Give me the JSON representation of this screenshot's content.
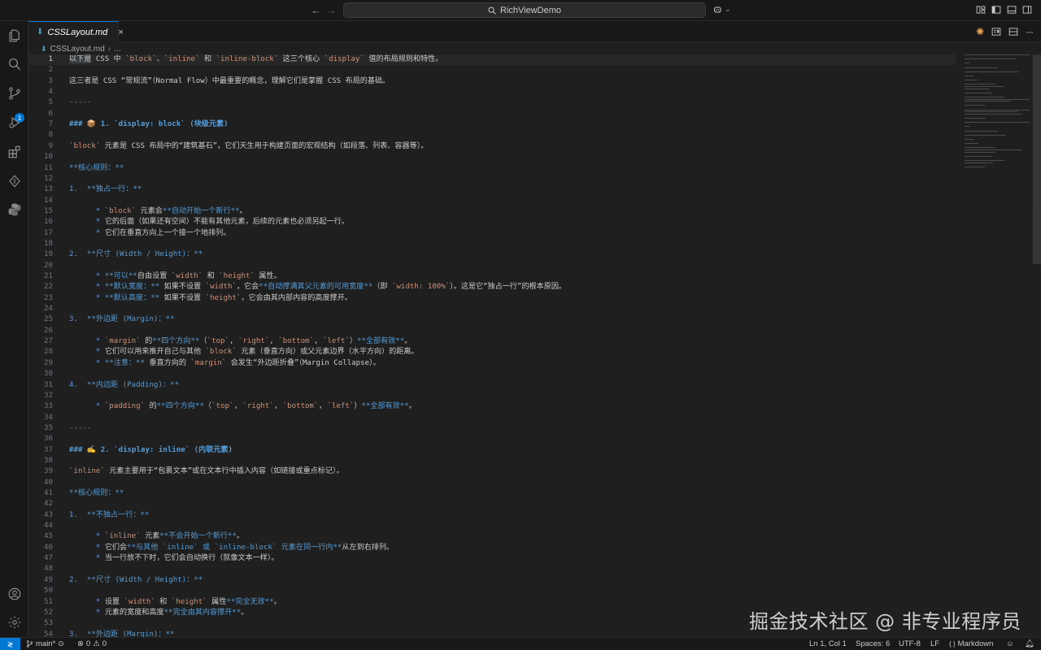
{
  "window": {
    "title": "RichViewDemo",
    "back_icon": "arrow-left-icon",
    "forward_icon": "arrow-right-icon"
  },
  "activity_bar": {
    "items": [
      "explorer-icon",
      "search-icon",
      "source-control-icon",
      "run-debug-icon",
      "extensions-icon",
      "remote-explorer-icon",
      "python-icon"
    ],
    "scm_badge": "1",
    "bottom_items": [
      "account-icon",
      "manage-gear-icon"
    ]
  },
  "tab": {
    "label": "CSSLayout.md",
    "close": "×"
  },
  "breadcrumb": {
    "file": "CSSLayout.md",
    "more": "..."
  },
  "editor": {
    "lines": [
      {
        "n": "1",
        "parts": [
          {
            "t": "以下是",
            "c": "hl"
          },
          {
            "t": " CSS 中 "
          },
          {
            "t": "`block`",
            "c": "code"
          },
          {
            "t": "、"
          },
          {
            "t": "`inline`",
            "c": "code"
          },
          {
            "t": " 和 "
          },
          {
            "t": "`inline-block`",
            "c": "code"
          },
          {
            "t": " 这三个核心 "
          },
          {
            "t": "`display`",
            "c": "code"
          },
          {
            "t": " 值的布局规则和特性。"
          }
        ]
      },
      {
        "n": "2",
        "parts": []
      },
      {
        "n": "3",
        "parts": [
          {
            "t": "这三者是 CSS “常规流”（Normal Flow）中最重要的概念，理解它们是掌握 CSS 布局的基础。"
          }
        ]
      },
      {
        "n": "4",
        "parts": []
      },
      {
        "n": "5",
        "parts": [
          {
            "t": "-----",
            "c": "hr"
          }
        ]
      },
      {
        "n": "6",
        "parts": []
      },
      {
        "n": "7",
        "parts": [
          {
            "t": "### 📦 1. `display: block` (块级元素)",
            "c": "head"
          }
        ]
      },
      {
        "n": "8",
        "parts": []
      },
      {
        "n": "9",
        "parts": [
          {
            "t": "`block`",
            "c": "code"
          },
          {
            "t": " 元素是 CSS 布局中的“建筑基石”，它们天生用于构建页面的宏观结构（如段落、列表、容器等）。"
          }
        ]
      },
      {
        "n": "10",
        "parts": []
      },
      {
        "n": "11",
        "parts": [
          {
            "t": "**核心规则：**",
            "c": "bold"
          }
        ]
      },
      {
        "n": "12",
        "parts": []
      },
      {
        "n": "13",
        "parts": [
          {
            "t": "1.  ",
            "c": "bullet"
          },
          {
            "t": "**独占一行：**",
            "c": "bold"
          }
        ]
      },
      {
        "n": "14",
        "parts": []
      },
      {
        "n": "15",
        "parts": [
          {
            "t": "      * ",
            "c": "bullet"
          },
          {
            "t": "`block`",
            "c": "code"
          },
          {
            "t": " 元素会"
          },
          {
            "t": "**自动开始一个新行**",
            "c": "bold"
          },
          {
            "t": "。"
          }
        ]
      },
      {
        "n": "16",
        "parts": [
          {
            "t": "      * ",
            "c": "bullet"
          },
          {
            "t": "它的后面（如果还有空间）不能有其他元素，后续的元素也必须另起一行。"
          }
        ]
      },
      {
        "n": "17",
        "parts": [
          {
            "t": "      * ",
            "c": "bullet"
          },
          {
            "t": "它们在垂直方向上一个接一个地排列。"
          }
        ]
      },
      {
        "n": "18",
        "parts": []
      },
      {
        "n": "19",
        "parts": [
          {
            "t": "2.  ",
            "c": "bullet"
          },
          {
            "t": "**尺寸 (Width / Height)：**",
            "c": "bold"
          }
        ]
      },
      {
        "n": "20",
        "parts": []
      },
      {
        "n": "21",
        "parts": [
          {
            "t": "      * ",
            "c": "bullet"
          },
          {
            "t": "**可以**",
            "c": "bold"
          },
          {
            "t": "自由设置 "
          },
          {
            "t": "`width`",
            "c": "code"
          },
          {
            "t": " 和 "
          },
          {
            "t": "`height`",
            "c": "code"
          },
          {
            "t": " 属性。"
          }
        ]
      },
      {
        "n": "22",
        "parts": [
          {
            "t": "      * ",
            "c": "bullet"
          },
          {
            "t": "**默认宽度：**",
            "c": "bold"
          },
          {
            "t": " 如果不设置 "
          },
          {
            "t": "`width`",
            "c": "code"
          },
          {
            "t": "，它会"
          },
          {
            "t": "**自动撑满其父元素的可用宽度**",
            "c": "bold"
          },
          {
            "t": "（即 "
          },
          {
            "t": "`width: 100%`",
            "c": "code"
          },
          {
            "t": "）。这是它“独占一行”的根本原因。"
          }
        ]
      },
      {
        "n": "23",
        "parts": [
          {
            "t": "      * ",
            "c": "bullet"
          },
          {
            "t": "**默认高度：**",
            "c": "bold"
          },
          {
            "t": " 如果不设置 "
          },
          {
            "t": "`height`",
            "c": "code"
          },
          {
            "t": "，它会由其内部内容的高度撑开。"
          }
        ]
      },
      {
        "n": "24",
        "parts": []
      },
      {
        "n": "25",
        "parts": [
          {
            "t": "3.  ",
            "c": "bullet"
          },
          {
            "t": "**外边距 (Margin)：**",
            "c": "bold"
          }
        ]
      },
      {
        "n": "26",
        "parts": []
      },
      {
        "n": "27",
        "parts": [
          {
            "t": "      * ",
            "c": "bullet"
          },
          {
            "t": "`margin`",
            "c": "code"
          },
          {
            "t": " 的"
          },
          {
            "t": "**四个方向**",
            "c": "bold"
          },
          {
            "t": "（"
          },
          {
            "t": "`top`",
            "c": "code"
          },
          {
            "t": ", "
          },
          {
            "t": "`right`",
            "c": "code"
          },
          {
            "t": ", "
          },
          {
            "t": "`bottom`",
            "c": "code"
          },
          {
            "t": ", "
          },
          {
            "t": "`left`",
            "c": "code"
          },
          {
            "t": "）"
          },
          {
            "t": "**全部有效**",
            "c": "bold"
          },
          {
            "t": "。"
          }
        ]
      },
      {
        "n": "28",
        "parts": [
          {
            "t": "      * ",
            "c": "bullet"
          },
          {
            "t": "它们可以用来推开自己与其他 "
          },
          {
            "t": "`block`",
            "c": "code"
          },
          {
            "t": " 元素（垂直方向）或父元素边界（水平方向）的距离。"
          }
        ]
      },
      {
        "n": "29",
        "parts": [
          {
            "t": "      * ",
            "c": "bullet"
          },
          {
            "t": "**注意：**",
            "c": "bold"
          },
          {
            "t": " 垂直方向的 "
          },
          {
            "t": "`margin`",
            "c": "code"
          },
          {
            "t": " 会发生“外边距折叠”（Margin Collapse）。"
          }
        ]
      },
      {
        "n": "30",
        "parts": []
      },
      {
        "n": "31",
        "parts": [
          {
            "t": "4.  ",
            "c": "bullet"
          },
          {
            "t": "**内边距 (Padding)：**",
            "c": "bold"
          }
        ]
      },
      {
        "n": "32",
        "parts": []
      },
      {
        "n": "33",
        "parts": [
          {
            "t": "      * ",
            "c": "bullet"
          },
          {
            "t": "`padding`",
            "c": "code"
          },
          {
            "t": " 的"
          },
          {
            "t": "**四个方向**",
            "c": "bold"
          },
          {
            "t": "（"
          },
          {
            "t": "`top`",
            "c": "code"
          },
          {
            "t": ", "
          },
          {
            "t": "`right`",
            "c": "code"
          },
          {
            "t": ", "
          },
          {
            "t": "`bottom`",
            "c": "code"
          },
          {
            "t": ", "
          },
          {
            "t": "`left`",
            "c": "code"
          },
          {
            "t": "）"
          },
          {
            "t": "**全部有效**",
            "c": "bold"
          },
          {
            "t": "。"
          }
        ]
      },
      {
        "n": "34",
        "parts": []
      },
      {
        "n": "35",
        "parts": [
          {
            "t": "-----",
            "c": "hr"
          }
        ]
      },
      {
        "n": "36",
        "parts": []
      },
      {
        "n": "37",
        "parts": [
          {
            "t": "### ✍️ 2. `display: inline` (内联元素)",
            "c": "head"
          }
        ]
      },
      {
        "n": "38",
        "parts": []
      },
      {
        "n": "39",
        "parts": [
          {
            "t": "`inline`",
            "c": "code"
          },
          {
            "t": " 元素主要用于“包裹文本”或在文本行中插入内容（如链接或重点标记）。"
          }
        ]
      },
      {
        "n": "40",
        "parts": []
      },
      {
        "n": "41",
        "parts": [
          {
            "t": "**核心规则：**",
            "c": "bold"
          }
        ]
      },
      {
        "n": "42",
        "parts": []
      },
      {
        "n": "43",
        "parts": [
          {
            "t": "1.  ",
            "c": "bullet"
          },
          {
            "t": "**不独占一行：**",
            "c": "bold"
          }
        ]
      },
      {
        "n": "44",
        "parts": []
      },
      {
        "n": "45",
        "parts": [
          {
            "t": "      * ",
            "c": "bullet"
          },
          {
            "t": "`inline`",
            "c": "code"
          },
          {
            "t": " 元素"
          },
          {
            "t": "**不会开始一个新行**",
            "c": "bold"
          },
          {
            "t": "。"
          }
        ]
      },
      {
        "n": "46",
        "parts": [
          {
            "t": "      * ",
            "c": "bullet"
          },
          {
            "t": "它们会"
          },
          {
            "t": "**与其他 `inline` 或 `inline-block` 元素在同一行内**",
            "c": "bold"
          },
          {
            "t": "从左到右排列。"
          }
        ]
      },
      {
        "n": "47",
        "parts": [
          {
            "t": "      * ",
            "c": "bullet"
          },
          {
            "t": "当一行放不下时，它们会自动换行（就像文本一样）。"
          }
        ]
      },
      {
        "n": "48",
        "parts": []
      },
      {
        "n": "49",
        "parts": [
          {
            "t": "2.  ",
            "c": "bullet"
          },
          {
            "t": "**尺寸 (Width / Height)：**",
            "c": "bold"
          }
        ]
      },
      {
        "n": "50",
        "parts": []
      },
      {
        "n": "51",
        "parts": [
          {
            "t": "      * ",
            "c": "bullet"
          },
          {
            "t": "设置 "
          },
          {
            "t": "`width`",
            "c": "code"
          },
          {
            "t": " 和 "
          },
          {
            "t": "`height`",
            "c": "code"
          },
          {
            "t": " 属性"
          },
          {
            "t": "**完全无效**",
            "c": "bold"
          },
          {
            "t": "。"
          }
        ]
      },
      {
        "n": "52",
        "parts": [
          {
            "t": "      * ",
            "c": "bullet"
          },
          {
            "t": "元素的宽度和高度"
          },
          {
            "t": "**完全由其内容撑开**",
            "c": "bold"
          },
          {
            "t": "。"
          }
        ]
      },
      {
        "n": "53",
        "parts": []
      },
      {
        "n": "54",
        "parts": [
          {
            "t": "3.  ",
            "c": "bullet"
          },
          {
            "t": "**外边距 (Margin)：**",
            "c": "bold"
          }
        ]
      }
    ]
  },
  "watermark": "掘金技术社区 @ 非专业程序员",
  "status_bar": {
    "branch": "main*",
    "errors": "0",
    "warnings": "0",
    "position": "Ln 1, Col 1",
    "spaces": "Spaces: 6",
    "encoding": "UTF-8",
    "eol": "LF",
    "language": "Markdown",
    "language_prefix": "{ }"
  }
}
